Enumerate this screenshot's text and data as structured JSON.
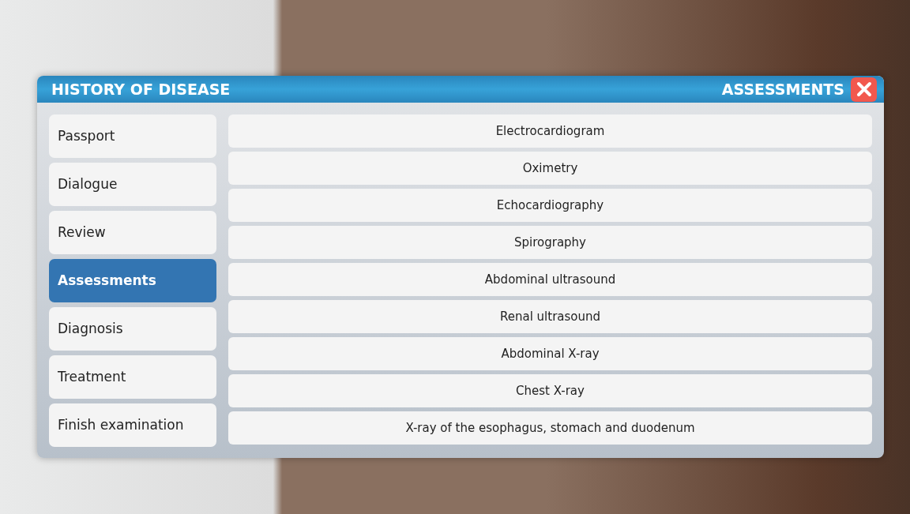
{
  "header": {
    "title": "HISTORY OF DISEASE",
    "section": "ASSESSMENTS"
  },
  "sidebar": {
    "items": [
      {
        "label": "Passport",
        "selected": false
      },
      {
        "label": "Dialogue",
        "selected": false
      },
      {
        "label": "Review",
        "selected": false
      },
      {
        "label": "Assessments",
        "selected": true
      },
      {
        "label": "Diagnosis",
        "selected": false
      },
      {
        "label": "Treatment",
        "selected": false
      },
      {
        "label": "Finish examination",
        "selected": false
      }
    ]
  },
  "assessments": [
    "Electrocardiogram",
    "Oximetry",
    "Echocardiography",
    "Spirography",
    "Abdominal ultrasound",
    "Renal ultrasound",
    "Abdominal X-ray",
    "Chest X-ray",
    "X-ray of the esophagus, stomach and duodenum"
  ]
}
